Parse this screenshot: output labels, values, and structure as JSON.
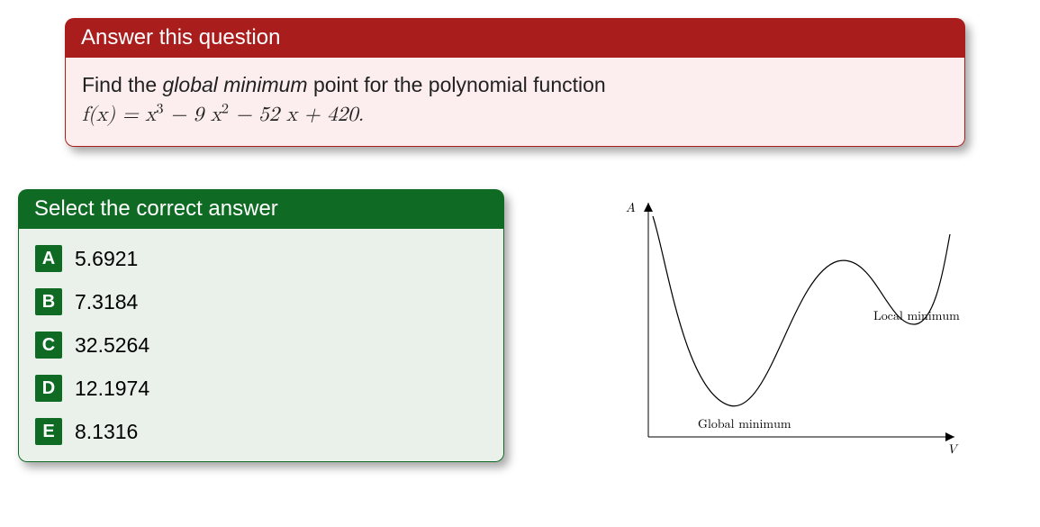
{
  "question": {
    "header": "Answer this question",
    "prompt_prefix": "Find the ",
    "prompt_emph": "global minimum",
    "prompt_suffix": " point for the polynomial function",
    "formula_html": "f(x) = x³ − 9 x² − 52 x + 420."
  },
  "answers": {
    "header": "Select the correct answer",
    "options": [
      {
        "letter": "A",
        "value": "5.6921"
      },
      {
        "letter": "B",
        "value": "7.3184"
      },
      {
        "letter": "C",
        "value": "32.5264"
      },
      {
        "letter": "D",
        "value": "12.1974"
      },
      {
        "letter": "E",
        "value": "8.1316"
      }
    ]
  },
  "diagram": {
    "y_axis_label": "A",
    "x_axis_label": "V",
    "global_min_label": "Global minimum",
    "local_min_label": "Local minimum"
  }
}
